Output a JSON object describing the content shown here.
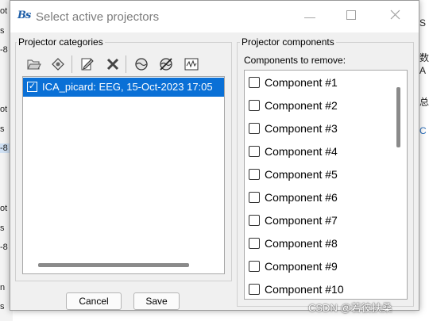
{
  "window": {
    "title": "Select active projectors",
    "app_icon_text": "Bs",
    "controls": {
      "minimize": "—",
      "maximize": "☐",
      "close": "✕"
    }
  },
  "left_panel": {
    "label": "Projector categories",
    "toolbar": [
      "open-folder-icon",
      "refresh-icon",
      "edit-icon",
      "delete-icon",
      "headmodel-icon",
      "no-headmodel-icon",
      "signal-icon"
    ],
    "items": [
      {
        "label": "ICA_picard: EEG, 15-Oct-2023 17:05",
        "checked": true,
        "selected": true
      }
    ]
  },
  "right_panel": {
    "label": "Projector components",
    "sublabel": "Components to remove:",
    "components": [
      "Component #1",
      "Component #2",
      "Component #3",
      "Component #4",
      "Component #5",
      "Component #6",
      "Component #7",
      "Component #8",
      "Component #9",
      "Component #10"
    ]
  },
  "buttons": {
    "cancel": "Cancel",
    "save": "Save"
  },
  "background_fragments": {
    "left": [
      "ot",
      "s",
      "-8",
      "ot",
      "s",
      "-8",
      "ot",
      "s",
      "-8",
      "n",
      "s"
    ],
    "right": [
      "S",
      "数",
      "A",
      "总",
      "C"
    ]
  },
  "watermark": "CSDN @若彼扶桑",
  "colors": {
    "selection": "#0a70d6",
    "dialog_bg": "#f0f0f0",
    "accent_text": "#2a6ebb"
  }
}
